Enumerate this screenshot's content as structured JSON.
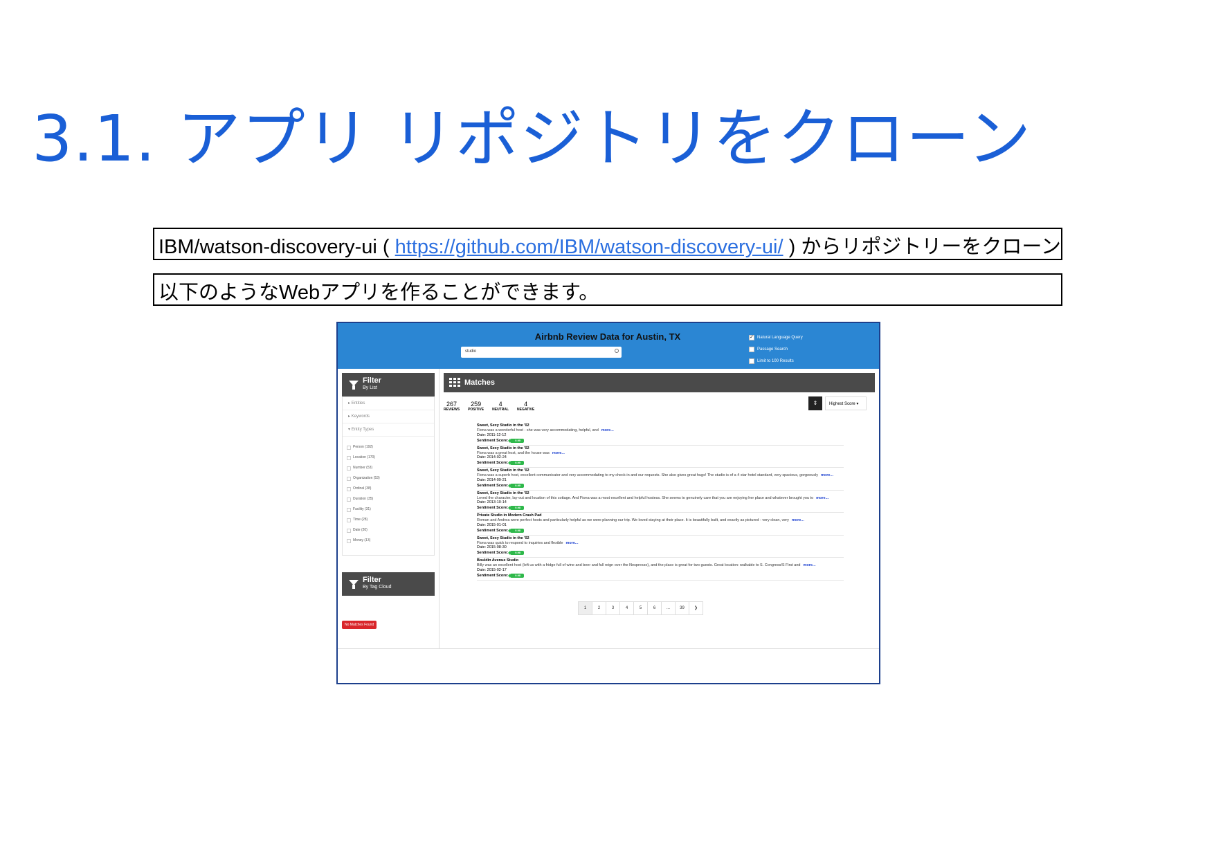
{
  "slide": {
    "title": "3.1. アプリ リポジトリをクローン",
    "line1_prefix": "IBM/watson-discovery-ui ( ",
    "line1_link": "https://github.com/IBM/watson-discovery-ui/",
    "line1_suffix": " ) からリポジトリーをクローン",
    "line2": "以下のようなWebアプリを作ることができます。"
  },
  "app": {
    "title": "Airbnb Review Data for Austin, TX",
    "search_value": "studio",
    "options": [
      {
        "label": "Natural Language Query",
        "checked": true
      },
      {
        "label": "Passage Search",
        "checked": false
      },
      {
        "label": "Limit to 100 Results",
        "checked": false
      }
    ],
    "filter_list": {
      "title": "Filter",
      "subtitle": "By List"
    },
    "categories": [
      "Entities",
      "Keywords",
      "Entity Types"
    ],
    "entity_types": [
      "Person (192)",
      "Location (170)",
      "Number (53)",
      "Organization (53)",
      "Ordinal (38)",
      "Duration (35)",
      "Facility (31)",
      "Time (28)",
      "Date (20)",
      "Money (13)"
    ],
    "filter_tag": {
      "title": "Filter",
      "subtitle": "By Tag Cloud"
    },
    "no_matches": "No Matches Found",
    "matches_title": "Matches",
    "stats": [
      {
        "n": "267",
        "l": "REVIEWS"
      },
      {
        "n": "259",
        "l": "POSITIVE"
      },
      {
        "n": "4",
        "l": "NEUTRAL"
      },
      {
        "n": "4",
        "l": "NEGATIVE"
      }
    ],
    "sort_label": "Highest Score",
    "sentiment_label": "Sentiment Score:",
    "more_label": "more...",
    "results": [
      {
        "title": "Sweet, Sexy Studio in the '02",
        "text": "Fiona was a wonderful host - she was very accommodating, helpful, and",
        "date": "Date: 2011-12-12",
        "score": "0.99"
      },
      {
        "title": "Sweet, Sexy Studio in the '02",
        "text": "Fiona was a great host, and the house was",
        "date": "Date: 2014-02-24",
        "score": "0.99"
      },
      {
        "title": "Sweet, Sexy Studio in the '02",
        "text": "Fiona was a superb host, excellent communicator and very accommodating to my check-in and our requests. She also gives great hugs! The studio is of a 4 star hotel standard, very spacious, gorgeously",
        "date": "Date: 2014-09-21",
        "score": "0.99"
      },
      {
        "title": "Sweet, Sexy Studio in the '02",
        "text": "Loved the character, lay-out and location of this cottage. And Fiona was a most excellent and helpful hostess. She seems to genuinely care that you are enjoying her place and whatever brought you to",
        "date": "Date: 2013-10-14",
        "score": "0.98"
      },
      {
        "title": "Private Studio in Modern Crash Pad",
        "text": "Roman and Andrea were perfect hosts and particularly helpful as we were planning our trip. We loved staying at their place. It is beautifully built, and exactly as pictured - very clean, very",
        "date": "Date: 2015-01-01",
        "score": "0.98"
      },
      {
        "title": "Sweet, Sexy Studio in the '02",
        "text": "Fiona was quick to respond to inquiries and flexible",
        "date": "Date: 2015-08-30",
        "score": "0.98"
      },
      {
        "title": "Bouldin Avenue Studio",
        "text": "Billy was an excellent host (left us with a fridge full of wine and beer and full reign over the Nespresso), and the place is great for two guests. Great location: walkable to S. Congress/S First and",
        "date": "Date: 2015-02-17",
        "score": "0.98"
      }
    ],
    "pages": [
      "1",
      "2",
      "3",
      "4",
      "5",
      "6",
      "...",
      "39",
      "❯"
    ],
    "current_page": "1"
  }
}
